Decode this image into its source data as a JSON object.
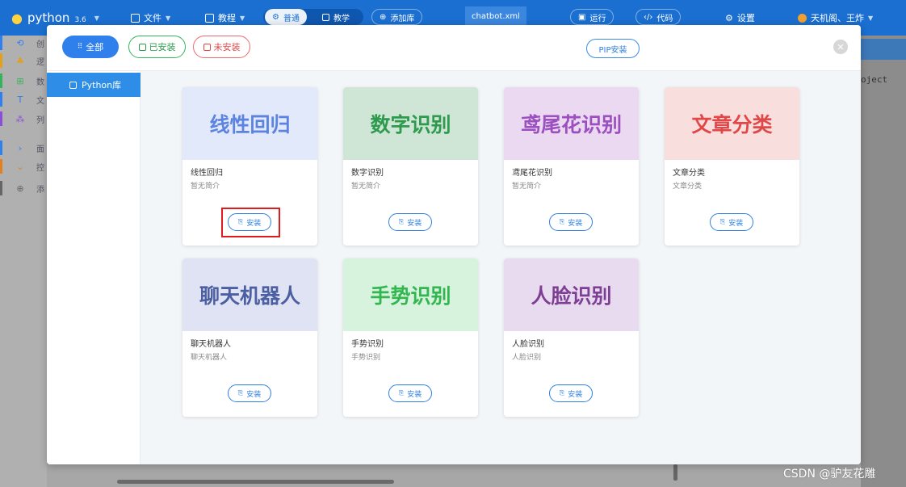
{
  "topbar": {
    "logo_text": "python",
    "version": "3.6",
    "file_label": "文件",
    "tutorial_label": "教程",
    "mode_normal": "普通",
    "mode_teach": "教学",
    "add_lib": "添加库",
    "file_tab": "chatbot.xml",
    "run_label": "运行",
    "code_label": "代码",
    "settings_label": "设置",
    "user_label": "天机阁、王炸"
  },
  "left_panel": {
    "items": [
      {
        "glyph": "⟲",
        "text": "创",
        "color": "#2f80ed"
      },
      {
        "glyph": "♣",
        "text": "逻",
        "color": "#e0a020"
      },
      {
        "glyph": "⊞",
        "text": "数",
        "color": "#35b35a"
      },
      {
        "glyph": "T",
        "text": "文",
        "color": "#2f80ed"
      },
      {
        "glyph": "⁂",
        "text": "列",
        "color": "#8a4fd6"
      },
      {
        "glyph": "›",
        "text": "面",
        "color": "#2f80ed"
      },
      {
        "glyph": "⌄",
        "text": "控",
        "color": "#e08020"
      },
      {
        "glyph": "⊕",
        "text": "添",
        "color": "#666666"
      }
    ]
  },
  "background": {
    "code_fragment": "oject"
  },
  "modal": {
    "filters": {
      "all": "全部",
      "installed": "已安装",
      "uninstalled": "未安装"
    },
    "pip_label": "PIP安装",
    "close_glyph": "✕",
    "sidebar": {
      "python_lib": "Python库"
    },
    "cards": [
      {
        "title": "线性回归",
        "name": "线性回归",
        "desc": "暂无简介",
        "install": "安装",
        "banner_bg": "#e2e9fb",
        "title_color": "#5c83e0"
      },
      {
        "title": "数字识别",
        "name": "数字识别",
        "desc": "暂无简介",
        "install": "安装",
        "banner_bg": "#cfe6d6",
        "title_color": "#2e9a4e"
      },
      {
        "title": "鸢尾花识别",
        "name": "鸢尾花识别",
        "desc": "暂无简介",
        "install": "安装",
        "banner_bg": "#ead9f0",
        "title_color": "#9b4fc0"
      },
      {
        "title": "文章分类",
        "name": "文章分类",
        "desc": "文章分类",
        "install": "安装",
        "banner_bg": "#f9dede",
        "title_color": "#e04848"
      },
      {
        "title": "聊天机器人",
        "name": "聊天机器人",
        "desc": "聊天机器人",
        "install": "安装",
        "banner_bg": "#dfe3f3",
        "title_color": "#4c5fa3"
      },
      {
        "title": "手势识别",
        "name": "手势识别",
        "desc": "手势识别",
        "install": "安装",
        "banner_bg": "#d8f3dd",
        "title_color": "#31b650"
      },
      {
        "title": "人脸识别",
        "name": "人脸识别",
        "desc": "人脸识别",
        "install": "安装",
        "banner_bg": "#e9dbef",
        "title_color": "#7d3f93"
      }
    ]
  },
  "watermark": "CSDN @驴友花雕",
  "colors": {
    "brand_blue": "#1a6fd1",
    "accent_blue": "#2f80ed",
    "highlight_red": "#e01b1b"
  }
}
